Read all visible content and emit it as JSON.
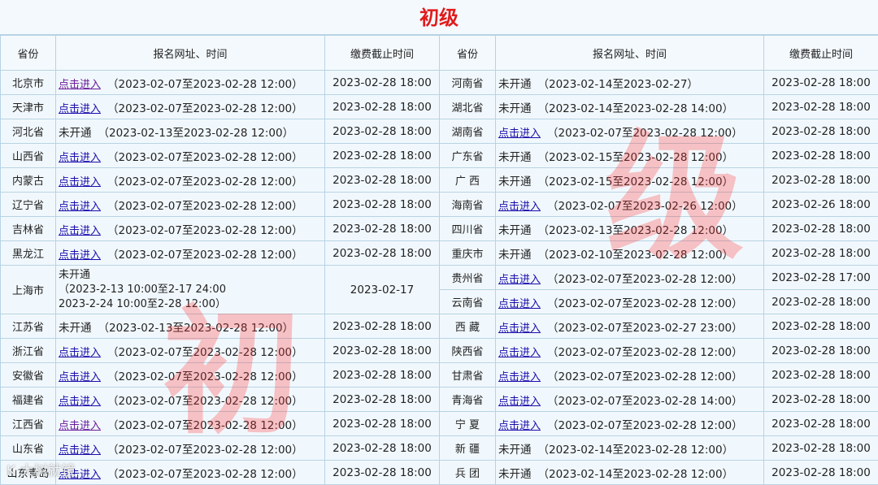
{
  "title": "初级",
  "watermark": "级",
  "watermark2": "初",
  "logo_text": "K 大树就镜",
  "headers": {
    "province": "省份",
    "register": "报名网址、时间",
    "deadline": "缴费截止时间"
  },
  "rows": [
    {
      "left": {
        "province": "北京市",
        "status": "点击进入",
        "visited": true,
        "period": "（2023-02-07至2023-02-28 12:00）",
        "deadline": "2023-02-28 18:00"
      },
      "right": {
        "province": "河南省",
        "status": "未开通",
        "visited": false,
        "period": "（2023-02-14至2023-02-27）",
        "deadline": "2023-02-28 18:00"
      }
    },
    {
      "left": {
        "province": "天津市",
        "status": "点击进入",
        "visited": false,
        "period": "（2023-02-07至2023-02-28 12:00）",
        "deadline": "2023-02-28 18:00"
      },
      "right": {
        "province": "湖北省",
        "status": "未开通",
        "visited": false,
        "period": "（2023-02-14至2023-02-28 14:00）",
        "deadline": "2023-02-28 18:00"
      }
    },
    {
      "left": {
        "province": "河北省",
        "status": "未开通",
        "visited": false,
        "period": "（2023-02-13至2023-02-28 12:00）",
        "deadline": "2023-02-28 18:00"
      },
      "right": {
        "province": "湖南省",
        "status": "点击进入",
        "visited": false,
        "period": "（2023-02-07至2023-02-28 12:00）",
        "deadline": "2023-02-28 18:00"
      }
    },
    {
      "left": {
        "province": "山西省",
        "status": "点击进入",
        "visited": false,
        "period": "（2023-02-07至2023-02-28 12:00）",
        "deadline": "2023-02-28 18:00"
      },
      "right": {
        "province": "广东省",
        "status": "未开通",
        "visited": false,
        "period": "（2023-02-15至2023-02-28 12:00）",
        "deadline": "2023-02-28 18:00"
      }
    },
    {
      "left": {
        "province": "内蒙古",
        "status": "点击进入",
        "visited": false,
        "period": "（2023-02-07至2023-02-28 12:00）",
        "deadline": "2023-02-28 18:00"
      },
      "right": {
        "province": "广 西",
        "status": "未开通",
        "visited": false,
        "period": "（2023-02-15至2023-02-28 12:00）",
        "deadline": "2023-02-28 18:00"
      }
    },
    {
      "left": {
        "province": "辽宁省",
        "status": "点击进入",
        "visited": false,
        "period": "（2023-02-07至2023-02-28 12:00）",
        "deadline": "2023-02-28 18:00"
      },
      "right": {
        "province": "海南省",
        "status": "点击进入",
        "visited": false,
        "period": "（2023-02-07至2023-02-26 12:00）",
        "deadline": "2023-02-26 18:00"
      }
    },
    {
      "left": {
        "province": "吉林省",
        "status": "点击进入",
        "visited": false,
        "period": "（2023-02-07至2023-02-28 12:00）",
        "deadline": "2023-02-28 18:00"
      },
      "right": {
        "province": "四川省",
        "status": "未开通",
        "visited": false,
        "period": "（2023-02-13至2023-02-28 12:00）",
        "deadline": "2023-02-28 18:00"
      }
    },
    {
      "left": {
        "province": "黑龙江",
        "status": "点击进入",
        "visited": false,
        "period": "（2023-02-07至2023-02-28 12:00）",
        "deadline": "2023-02-28 18:00"
      },
      "right": {
        "province": "重庆市",
        "status": "未开通",
        "visited": false,
        "period": "（2023-02-10至2023-02-28 12:00）",
        "deadline": "2023-02-28 18:00"
      }
    }
  ],
  "shanghai": {
    "province": "上海市",
    "status": "未开通",
    "line1": "（2023-2-13 10:00至2-17 24:00",
    "line2": "2023-2-24 10:00至2-28 12:00）",
    "deadline": "2023-02-17",
    "right_a": {
      "province": "贵州省",
      "status": "点击进入",
      "visited": false,
      "period": "（2023-02-07至2023-02-28 12:00）",
      "deadline": "2023-02-28 17:00"
    },
    "right_b": {
      "province": "云南省",
      "status": "点击进入",
      "visited": false,
      "period": "（2023-02-07至2023-02-28 12:00）",
      "deadline": "2023-02-28 18:00"
    }
  },
  "rows2": [
    {
      "left": {
        "province": "江苏省",
        "status": "未开通",
        "visited": false,
        "period": "（2023-02-13至2023-02-28 12:00）",
        "deadline": "2023-02-28 18:00"
      },
      "right": {
        "province": "西 藏",
        "status": "点击进入",
        "visited": false,
        "period": "（2023-02-07至2023-02-27 23:00）",
        "deadline": "2023-02-28 18:00"
      }
    },
    {
      "left": {
        "province": "浙江省",
        "status": "点击进入",
        "visited": false,
        "period": "（2023-02-07至2023-02-28 12:00）",
        "deadline": "2023-02-28 18:00"
      },
      "right": {
        "province": "陕西省",
        "status": "点击进入",
        "visited": false,
        "period": "（2023-02-07至2023-02-28 12:00）",
        "deadline": "2023-02-28 18:00"
      }
    },
    {
      "left": {
        "province": "安徽省",
        "status": "点击进入",
        "visited": false,
        "period": "（2023-02-07至2023-02-28 12:00）",
        "deadline": "2023-02-28 18:00"
      },
      "right": {
        "province": "甘肃省",
        "status": "点击进入",
        "visited": false,
        "period": "（2023-02-07至2023-02-28 12:00）",
        "deadline": "2023-02-28 18:00"
      }
    },
    {
      "left": {
        "province": "福建省",
        "status": "点击进入",
        "visited": false,
        "period": "（2023-02-07至2023-02-28 12:00）",
        "deadline": "2023-02-28 18:00"
      },
      "right": {
        "province": "青海省",
        "status": "点击进入",
        "visited": false,
        "period": "（2023-02-07至2023-02-28 14:00）",
        "deadline": "2023-02-28 18:00"
      }
    },
    {
      "left": {
        "province": "江西省",
        "status": "点击进入",
        "visited": true,
        "period": "（2023-02-07至2023-02-28 12:00）",
        "deadline": "2023-02-28 18:00"
      },
      "right": {
        "province": "宁 夏",
        "status": "点击进入",
        "visited": false,
        "period": "（2023-02-07至2023-02-28 12:00）",
        "deadline": "2023-02-28 18:00"
      }
    },
    {
      "left": {
        "province": "山东省",
        "status": "点击进入",
        "visited": false,
        "period": "（2023-02-07至2023-02-28 12:00）",
        "deadline": "2023-02-28 18:00"
      },
      "right": {
        "province": "新 疆",
        "status": "未开通",
        "visited": false,
        "period": "（2023-02-14至2023-02-28 12:00）",
        "deadline": "2023-02-28 18:00"
      }
    },
    {
      "left": {
        "province": "山东青岛",
        "status": "点击进入",
        "visited": false,
        "period": "（2023-02-07至2023-02-28 12:00）",
        "deadline": "2023-02-28 18:00"
      },
      "right": {
        "province": "兵 团",
        "status": "未开通",
        "visited": false,
        "period": "（2023-02-14至2023-02-28 12:00）",
        "deadline": "2023-02-28 18:00"
      }
    }
  ],
  "colors": {
    "title": "#e01b1b",
    "link": "#1a0dab",
    "visited_link": "#6a1b9a",
    "border": "#b7d3e3",
    "background": "#f1f8fd"
  }
}
